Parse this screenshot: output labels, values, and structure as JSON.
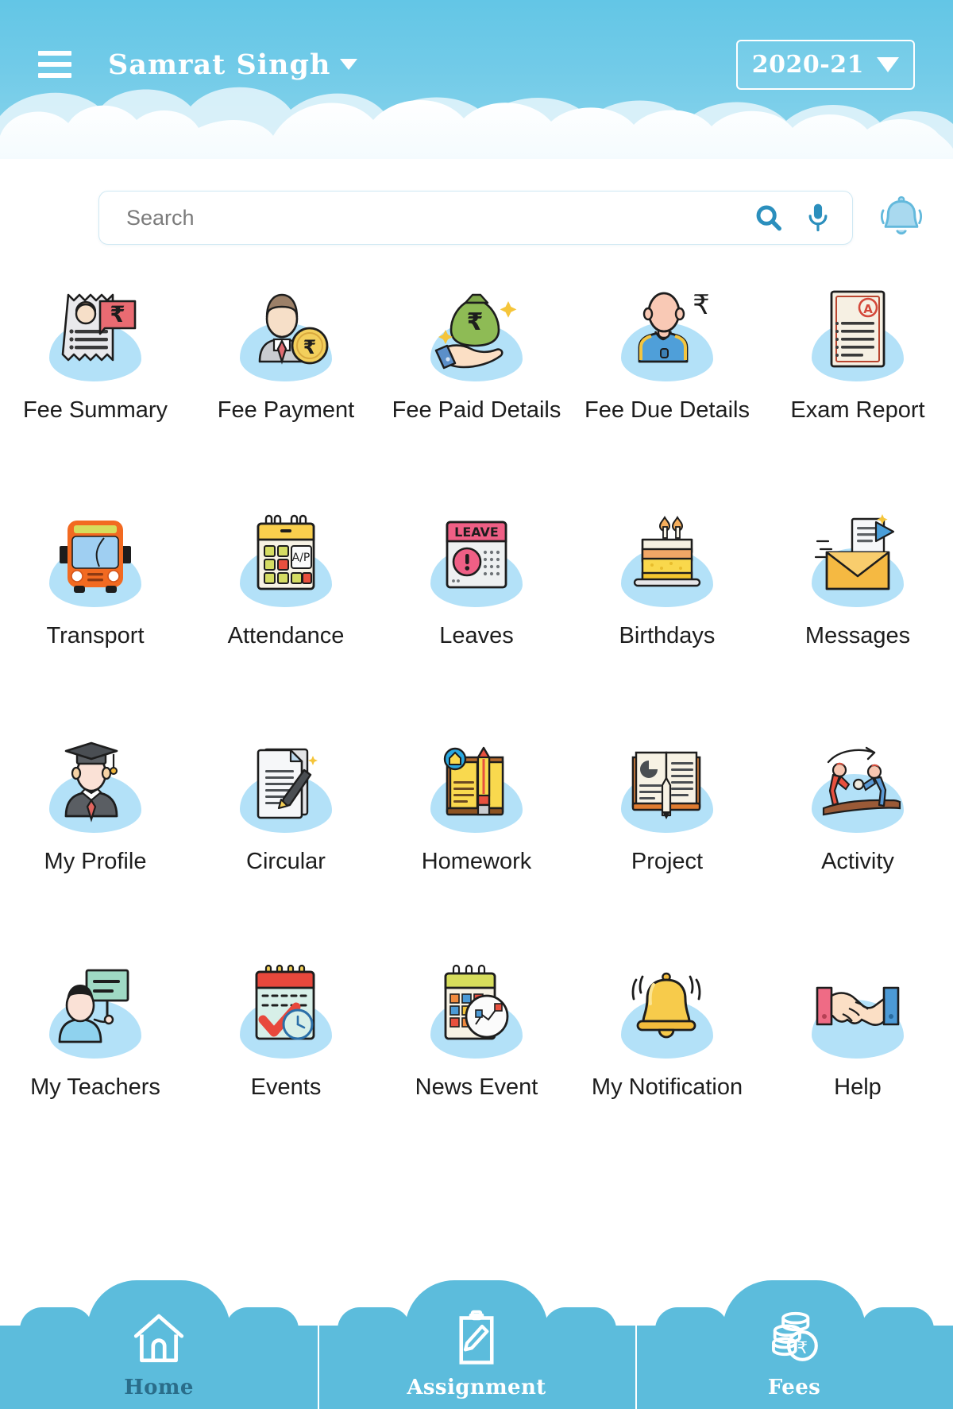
{
  "header": {
    "menu_icon": "hamburger-menu-icon",
    "user_name": "Samrat  Singh",
    "user_dropdown_icon": "caret-down-icon",
    "academic_year": "2020-21",
    "year_dropdown_icon": "caret-down-icon",
    "bg_color": "#72cbe8"
  },
  "search": {
    "placeholder": "Search",
    "value": "",
    "search_icon": "search-icon",
    "mic_icon": "microphone-icon",
    "bell_icon": "notification-bell-icon",
    "accent_color": "#2b8fbd"
  },
  "grid": {
    "items": [
      {
        "label": "Fee Summary",
        "icon": "receipt-rupee-icon"
      },
      {
        "label": "Fee Payment",
        "icon": "person-rupee-coin-icon"
      },
      {
        "label": "Fee Paid Details",
        "icon": "hand-money-bag-icon"
      },
      {
        "label": "Fee Due Details",
        "icon": "person-rupee-due-icon"
      },
      {
        "label": "Exam Report",
        "icon": "report-card-grade-a-icon"
      },
      {
        "label": "Transport",
        "icon": "school-bus-icon"
      },
      {
        "label": "Attendance",
        "icon": "calendar-attendance-icon"
      },
      {
        "label": "Leaves",
        "icon": "leave-calendar-alert-icon"
      },
      {
        "label": "Birthdays",
        "icon": "birthday-cake-icon"
      },
      {
        "label": "Messages",
        "icon": "envelope-message-icon"
      },
      {
        "label": "My Profile",
        "icon": "graduate-profile-icon"
      },
      {
        "label": "Circular",
        "icon": "document-pen-icon"
      },
      {
        "label": "Homework",
        "icon": "book-pencil-icon"
      },
      {
        "label": "Project",
        "icon": "open-book-pencil-icon"
      },
      {
        "label": "Activity",
        "icon": "sports-activity-icon"
      },
      {
        "label": "My Teachers",
        "icon": "teacher-board-icon"
      },
      {
        "label": "Events",
        "icon": "calendar-check-clock-icon"
      },
      {
        "label": "News Event",
        "icon": "calendar-news-icon"
      },
      {
        "label": "My Notification",
        "icon": "ringing-bell-icon"
      },
      {
        "label": "Help",
        "icon": "handshake-help-icon"
      }
    ]
  },
  "bottom_nav": {
    "items": [
      {
        "label": "Home",
        "icon": "home-icon",
        "active": true
      },
      {
        "label": "Assignment",
        "icon": "clipboard-pen-icon",
        "active": false
      },
      {
        "label": "Fees",
        "icon": "coins-rupee-icon",
        "active": false
      }
    ],
    "bar_color": "#5cbcdc",
    "active_label_color": "#2a6d8a"
  }
}
